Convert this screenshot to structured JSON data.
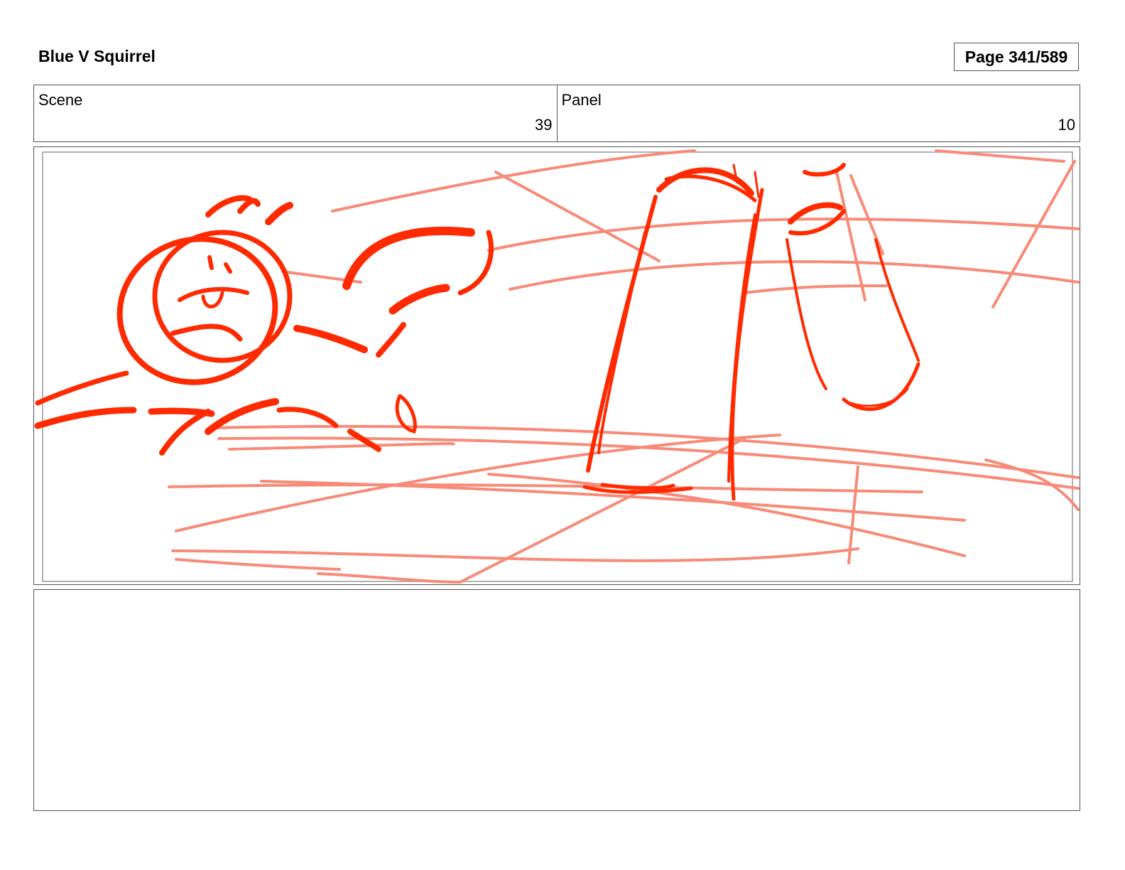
{
  "header": {
    "title": "Blue V Squirrel",
    "page_label": "Page 341/589"
  },
  "info": {
    "scene_label": "Scene",
    "scene_value": "39",
    "panel_label": "Panel",
    "panel_value": "10"
  },
  "sketch": {
    "stroke_color": "#ff2a00",
    "light_stroke_color": "#f88a78"
  },
  "notes": {
    "text": ""
  }
}
